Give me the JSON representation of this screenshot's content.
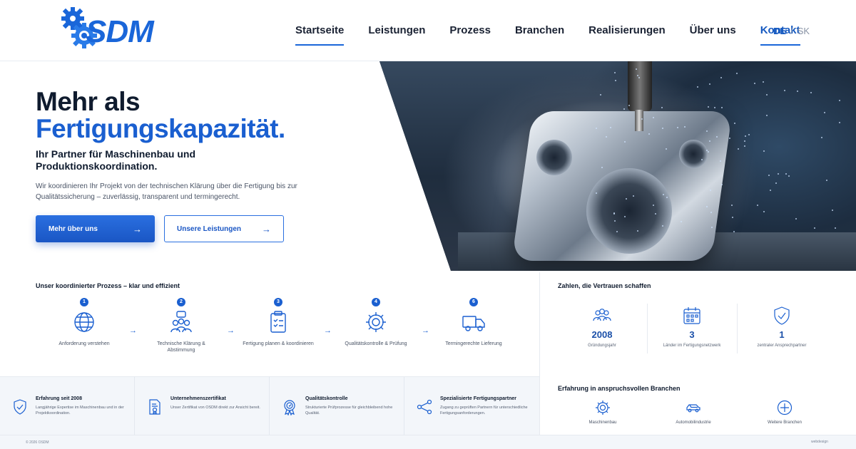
{
  "brand": {
    "name": "SDM",
    "accent": "#1a5fd0",
    "dark": "#0f1b2e"
  },
  "nav": {
    "items": [
      {
        "label": "Startseite"
      },
      {
        "label": "Leistungen"
      },
      {
        "label": "Prozess"
      },
      {
        "label": "Branchen"
      },
      {
        "label": "Realisierungen"
      },
      {
        "label": "Über uns"
      },
      {
        "label": "Kontakt"
      }
    ],
    "lang_active": "DE",
    "lang_sep": "/",
    "lang_other": "SK"
  },
  "hero": {
    "title_line1": "Mehr als",
    "title_line2": "Fertigungskapazität.",
    "subtitle": "Ihr Partner für Maschinenbau und Produktionskoordination.",
    "description": "Wir koordinieren Ihr Projekt von der technischen Klärung über die Fertigung bis zur Qualitätssicherung – zuverlässig, transparent und termingerecht.",
    "primary_button": "Mehr über uns",
    "secondary_button": "Unsere Leistungen"
  },
  "process": {
    "title": "Unser koordinierter Prozess – klar und effizient",
    "steps": [
      {
        "num": "1",
        "label": "Anforderung verstehen",
        "icon": "globe-icon"
      },
      {
        "num": "2",
        "label": "Technische Klärung & Abstimmung",
        "icon": "team-icon"
      },
      {
        "num": "3",
        "label": "Fertigung planen & koordinieren",
        "icon": "clipboard-icon"
      },
      {
        "num": "4",
        "label": "Qualitätskontrolle & Prüfung",
        "icon": "gear-icon"
      },
      {
        "num": "6",
        "label": "Termingerechte Lieferung",
        "icon": "truck-icon"
      }
    ]
  },
  "stats": {
    "title": "Zahlen, die Vertrauen schaffen",
    "items": [
      {
        "value": "2008",
        "label": "Gründungsjahr",
        "icon": "people-icon"
      },
      {
        "value": "3",
        "label": "Länder im Fertigungsnetzwerk",
        "icon": "calendar-icon"
      },
      {
        "value": "1",
        "label": "zentraler Ansprechpartner",
        "icon": "shield-check-icon"
      }
    ]
  },
  "features": [
    {
      "title": "Erfahrung seit 2008",
      "desc": "Langjährige Expertise im Maschinenbau und in der Projektkoordination.",
      "icon": "shield-check-icon"
    },
    {
      "title": "Unternehmenszertifikat",
      "desc": "Unser Zertifikat von OSDM direkt zur Ansicht bereit.",
      "icon": "certificate-icon"
    },
    {
      "title": "Qualitätskontrolle",
      "desc": "Strukturierte Prüfprozesse für gleichbleibend hohe Qualität.",
      "icon": "badge-icon"
    },
    {
      "title": "Spezialisierte Fertigungspartner",
      "desc": "Zugang zu geprüften Partnern für unterschiedliche Fertigungsanforderungen.",
      "icon": "network-icon"
    }
  ],
  "industries": {
    "title": "Erfahrung in anspruchsvollen Branchen",
    "items": [
      {
        "label": "Maschinenbau",
        "icon": "gear-icon"
      },
      {
        "label": "Automobilindustrie",
        "icon": "car-icon"
      },
      {
        "label": "Weitere Branchen",
        "icon": "plus-circle-icon"
      }
    ]
  },
  "footer": {
    "copyright": "© 2026 OSDM",
    "credit": "webdesign"
  }
}
